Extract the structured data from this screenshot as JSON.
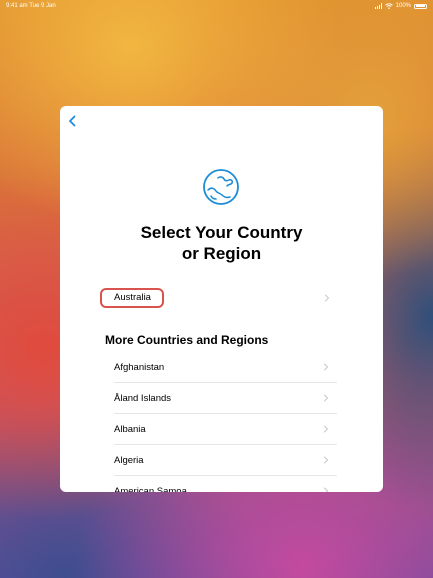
{
  "status_bar": {
    "time": "9:41 am  Tue 9 Jan",
    "battery": "100%"
  },
  "page": {
    "title": "Select Your Country or Region",
    "title_line1": "Select Your Country",
    "title_line2": "or Region"
  },
  "suggested": {
    "label": "Australia"
  },
  "more": {
    "header": "More Countries and Regions",
    "items": [
      {
        "label": "Afghanistan"
      },
      {
        "label": "Åland Islands"
      },
      {
        "label": "Albania"
      },
      {
        "label": "Algeria"
      },
      {
        "label": "American Samoa"
      }
    ]
  },
  "colors": {
    "accent": "#1a8cd8",
    "highlight": "#d9534f"
  },
  "icons": [
    "back-chevron-icon",
    "globe-icon",
    "chevron-right-icon",
    "signal-icon",
    "wifi-icon",
    "battery-icon"
  ]
}
